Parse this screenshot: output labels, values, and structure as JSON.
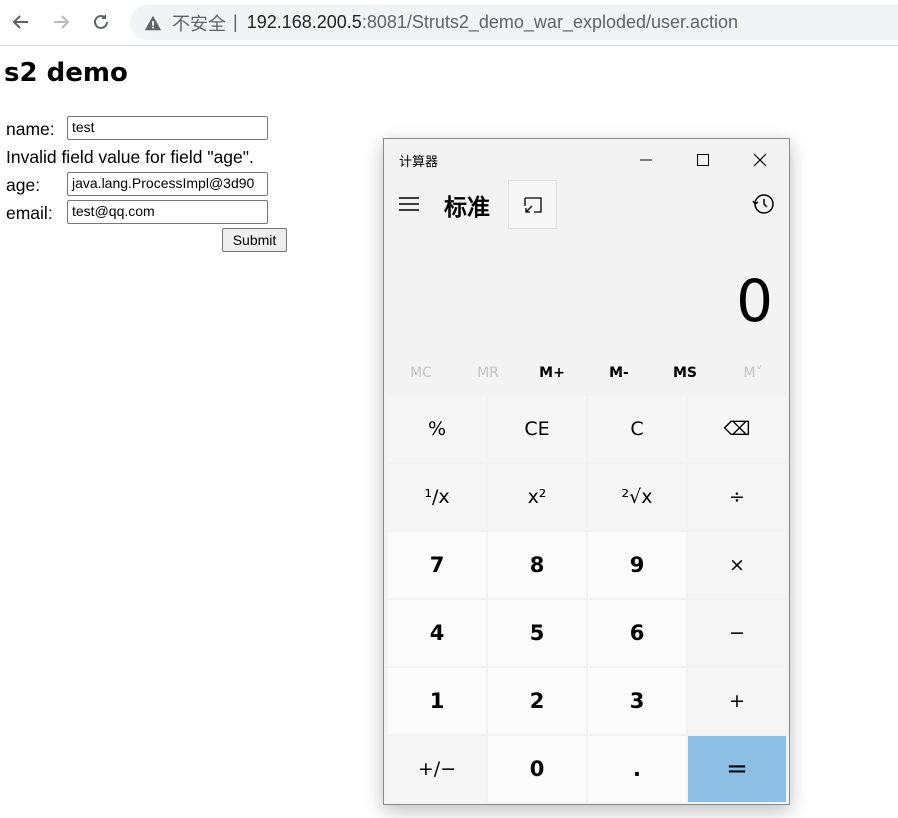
{
  "browser": {
    "insecure_label": "不安全",
    "separator": "|",
    "url_host": "192.168.200.5",
    "url_rest": ":8081/Struts2_demo_war_exploded/user.action"
  },
  "page": {
    "title": "s2 demo",
    "form": {
      "name_label": "name:",
      "name_value": "test",
      "error": "Invalid field value for field \"age\".",
      "age_label": "age:",
      "age_value": "java.lang.ProcessImpl@3d90",
      "email_label": "email:",
      "email_value": "test@qq.com",
      "submit_label": "Submit"
    }
  },
  "calculator": {
    "window_title": "计算器",
    "mode": "标准",
    "display": "0",
    "memory": [
      "MC",
      "MR",
      "M+",
      "M-",
      "MS",
      "M˅"
    ],
    "keys": [
      "%",
      "CE",
      "C",
      "⌫",
      "¹/x",
      "x²",
      "²√x",
      "÷",
      "7",
      "8",
      "9",
      "×",
      "4",
      "5",
      "6",
      "−",
      "1",
      "2",
      "3",
      "+",
      "+/−",
      "0",
      ".",
      "="
    ]
  },
  "colors": {
    "equals_key": "#8dbfe5",
    "omnibox": "#f1f3f4"
  }
}
